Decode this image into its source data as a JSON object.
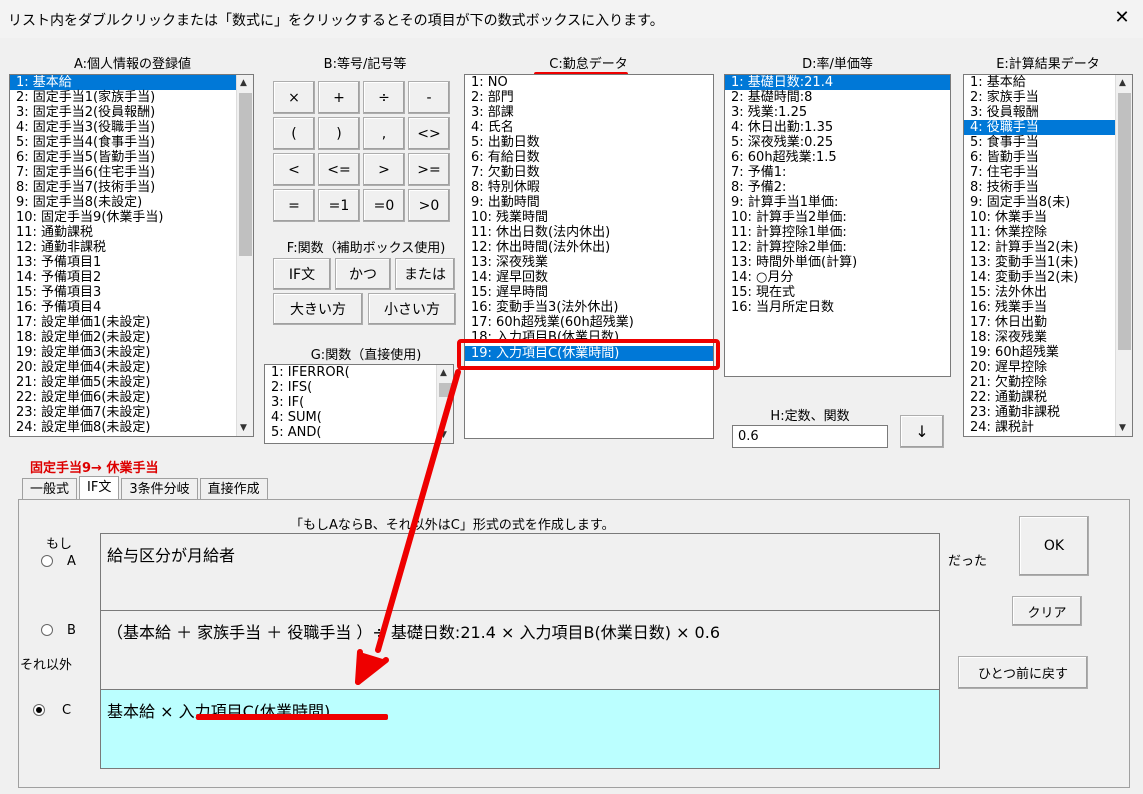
{
  "window": {
    "title": "リスト内をダブルクリックまたは「数式に」をクリックするとその項目が下の数式ボックスに入ります。"
  },
  "panels": {
    "a": {
      "title": "A:個人情報の登録値",
      "items": [
        "1: 基本給",
        "2: 固定手当1(家族手当)",
        "3: 固定手当2(役員報酬)",
        "4: 固定手当3(役職手当)",
        "5: 固定手当4(食事手当)",
        "6: 固定手当5(皆勤手当)",
        "7: 固定手当6(住宅手当)",
        "8: 固定手当7(技術手当)",
        "9: 固定手当8(未設定)",
        "10: 固定手当9(休業手当)",
        "11: 通勤課税",
        "12: 通勤非課税",
        "13: 予備項目1",
        "14: 予備項目2",
        "15: 予備項目3",
        "16: 予備項目4",
        "17: 設定単価1(未設定)",
        "18: 設定単価2(未設定)",
        "19: 設定単価3(未設定)",
        "20: 設定単価4(未設定)",
        "21: 設定単価5(未設定)",
        "22: 設定単価6(未設定)",
        "23: 設定単価7(未設定)",
        "24: 設定単価8(未設定)"
      ],
      "selected": 0
    },
    "b": {
      "title": "B:等号/記号等",
      "buttons": [
        "×",
        "+",
        "÷",
        "-",
        "(",
        ")",
        ",",
        "<>",
        "<",
        "<=",
        ">",
        ">=",
        "=",
        "=1",
        "=0",
        ">0"
      ]
    },
    "c": {
      "title": "C:勤怠データ",
      "items": [
        "1: NO",
        "2: 部門",
        "3: 部課",
        "4: 氏名",
        "5: 出勤日数",
        "6: 有給日数",
        "7: 欠勤日数",
        "8: 特別休暇",
        "9: 出勤時間",
        "10: 残業時間",
        "11: 休出日数(法内休出)",
        "12: 休出時間(法外休出)",
        "13: 深夜残業",
        "14: 遅早回数",
        "15: 遅早時間",
        "16: 変動手当3(法外休出)",
        "17: 60h超残業(60h超残業)",
        "18: 入力項目B(休業日数)",
        "19: 入力項目C(休業時間)"
      ],
      "selected": 18
    },
    "d": {
      "title": "D:率/単価等",
      "items": [
        "1: 基礎日数:21.4",
        "2: 基礎時間:8",
        "3: 残業:1.25",
        "4: 休日出勤:1.35",
        "5: 深夜残業:0.25",
        "6: 60h超残業:1.5",
        "7: 予備1:",
        "8: 予備2:",
        "9: 計算手当1単価:",
        "10: 計算手当2単価:",
        "11: 計算控除1単価:",
        "12: 計算控除2単価:",
        "13: 時間外単価(計算)",
        "14: ○月分",
        "15: 現在式",
        "16: 当月所定日数"
      ],
      "selected": 0
    },
    "e": {
      "title": "E:計算結果データ",
      "items": [
        "1: 基本給",
        "2: 家族手当",
        "3: 役員報酬",
        "4: 役職手当",
        "5: 食事手当",
        "6: 皆勤手当",
        "7: 住宅手当",
        "8: 技術手当",
        "9: 固定手当8(未)",
        "10: 休業手当",
        "11: 休業控除",
        "12: 計算手当2(未)",
        "13: 変動手当1(未)",
        "14: 変動手当2(未)",
        "15: 法外休出",
        "16: 残業手当",
        "17: 休日出勤",
        "18: 深夜残業",
        "19: 60h超残業",
        "20: 遅早控除",
        "21: 欠勤控除",
        "22: 通勤課税",
        "23: 通勤非課税",
        "24: 課税計"
      ],
      "selected": 3
    },
    "f": {
      "title": "F:関数（補助ボックス使用)",
      "buttons": [
        "IF文",
        "かつ",
        "または",
        "大きい方",
        "小さい方"
      ]
    },
    "g": {
      "title": "G:関数（直接使用)",
      "items": [
        "1: IFERROR(",
        "2: IFS(",
        "3: IF(",
        "4: SUM(",
        "5: AND("
      ]
    },
    "h": {
      "title": "H:定数、関数",
      "value": "0.6",
      "arrow": "↓"
    }
  },
  "target_label": "固定手当9→ 休業手当",
  "tabs": [
    "一般式",
    "IF文",
    "3条件分岐",
    "直接作成"
  ],
  "active_tab": 1,
  "ifform": {
    "instruction": "「もしAならB、それ以外はC」形式の式を作成します。",
    "if_label": "もし",
    "a_label": "A",
    "b_label": "B",
    "else_label": "それ以外",
    "c_label": "C",
    "a_text": "給与区分が月給者",
    "b_text": "（基本給 ＋ 家族手当 ＋ 役職手当 ）÷ 基礎日数:21.4 × 入力項目B(休業日数) × 0.6",
    "c_text": "基本給 × 入力項目C(休業時間)",
    "datta": "だった",
    "ok": "OK",
    "clear": "クリア",
    "undo": "ひとつ前に戻す",
    "selected_radio": "C"
  },
  "colors": {
    "accent": "#0078d7",
    "highlight": "#e00000",
    "formula_c_bg": "#bbffff"
  }
}
